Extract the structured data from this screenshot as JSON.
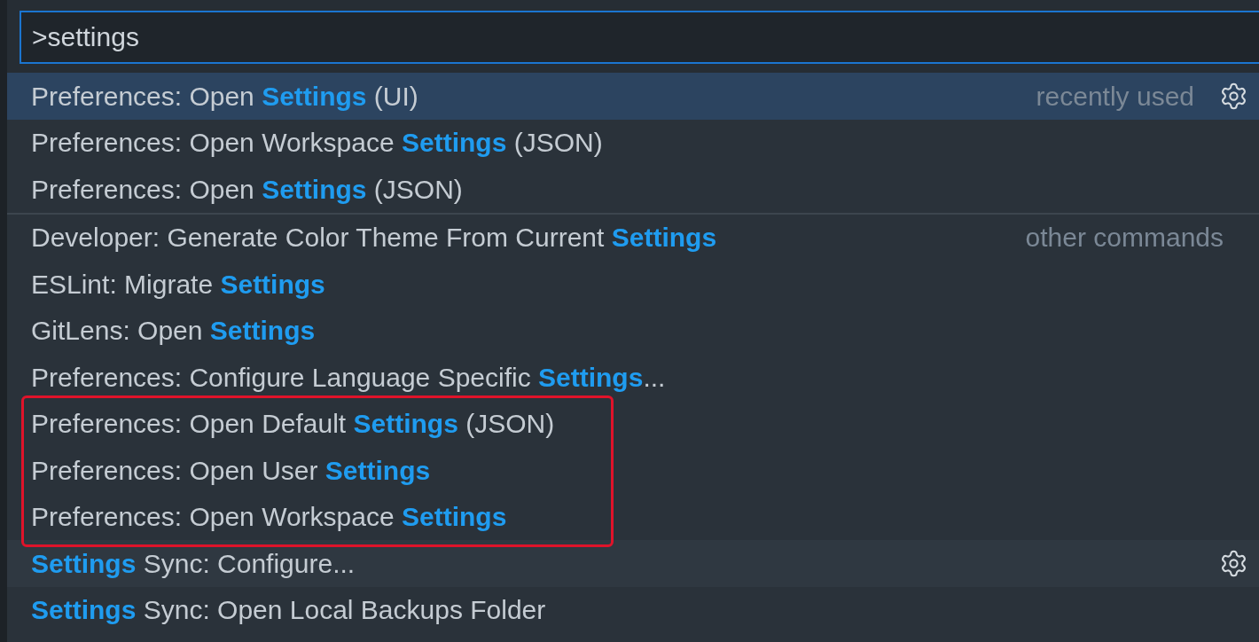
{
  "search": {
    "value": ">settings"
  },
  "groups": [
    {
      "label": "recently used",
      "rows": [
        {
          "parts": [
            {
              "text": "Preferences: Open ",
              "match": false
            },
            {
              "text": "Settings",
              "match": true
            },
            {
              "text": " (UI)",
              "match": false
            }
          ],
          "selected": true,
          "gear": true,
          "framed": false
        },
        {
          "parts": [
            {
              "text": "Preferences: Open Workspace ",
              "match": false
            },
            {
              "text": "Settings",
              "match": true
            },
            {
              "text": " (JSON)",
              "match": false
            }
          ],
          "selected": false,
          "framed": false
        },
        {
          "parts": [
            {
              "text": "Preferences: Open ",
              "match": false
            },
            {
              "text": "Settings",
              "match": true
            },
            {
              "text": " (JSON)",
              "match": false
            }
          ],
          "selected": false,
          "framed": false
        }
      ]
    },
    {
      "label": "other commands",
      "rows": [
        {
          "parts": [
            {
              "text": "Developer: Generate Color Theme From Current ",
              "match": false
            },
            {
              "text": "Settings",
              "match": true
            }
          ],
          "selected": false,
          "framed": false
        },
        {
          "parts": [
            {
              "text": "ESLint: Migrate ",
              "match": false
            },
            {
              "text": "Settings",
              "match": true
            }
          ],
          "selected": false,
          "framed": false
        },
        {
          "parts": [
            {
              "text": "GitLens: Open ",
              "match": false
            },
            {
              "text": "Settings",
              "match": true
            }
          ],
          "selected": false,
          "framed": false
        },
        {
          "parts": [
            {
              "text": "Preferences: Configure Language Specific ",
              "match": false
            },
            {
              "text": "Settings",
              "match": true
            },
            {
              "text": "...",
              "match": false
            }
          ],
          "selected": false,
          "framed": false
        },
        {
          "parts": [
            {
              "text": "Preferences: Open Default ",
              "match": false
            },
            {
              "text": "Settings",
              "match": true
            },
            {
              "text": " (JSON)",
              "match": false
            }
          ],
          "selected": false,
          "framed": true
        },
        {
          "parts": [
            {
              "text": "Preferences: Open User ",
              "match": false
            },
            {
              "text": "Settings",
              "match": true
            }
          ],
          "selected": false,
          "framed": true
        },
        {
          "parts": [
            {
              "text": "Preferences: Open Workspace ",
              "match": false
            },
            {
              "text": "Settings",
              "match": true
            }
          ],
          "selected": false,
          "framed": true
        },
        {
          "parts": [
            {
              "text": "Settings",
              "match": true
            },
            {
              "text": " Sync: Configure...",
              "match": false
            }
          ],
          "selected": false,
          "gear": true,
          "framed": false
        },
        {
          "parts": [
            {
              "text": "Settings",
              "match": true
            },
            {
              "text": " Sync: Open Local Backups Folder",
              "match": false
            }
          ],
          "selected": false,
          "framed": false
        }
      ]
    }
  ]
}
